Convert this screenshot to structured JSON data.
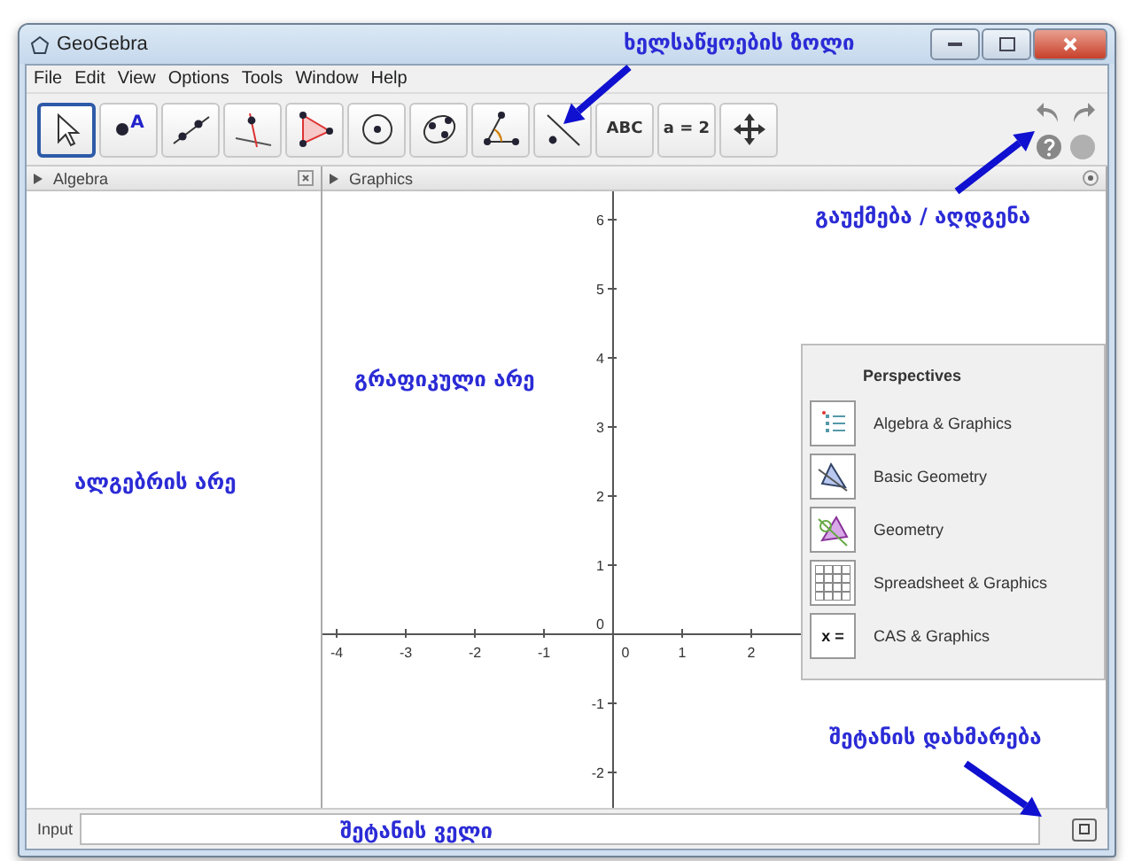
{
  "window": {
    "title": "GeoGebra"
  },
  "menu": [
    "File",
    "Edit",
    "View",
    "Options",
    "Tools",
    "Window",
    "Help"
  ],
  "tools": [
    {
      "kind": "move",
      "selected": true
    },
    {
      "kind": "point",
      "label": "A",
      "selected": false
    },
    {
      "kind": "line",
      "selected": false
    },
    {
      "kind": "perpendicular",
      "selected": false
    },
    {
      "kind": "polygon",
      "selected": false
    },
    {
      "kind": "circle",
      "selected": false
    },
    {
      "kind": "conic",
      "selected": false
    },
    {
      "kind": "angle",
      "selected": false
    },
    {
      "kind": "reflect",
      "selected": false
    },
    {
      "kind": "text",
      "label": "ABC",
      "selected": false
    },
    {
      "kind": "slider",
      "label": "a = 2",
      "selected": false
    },
    {
      "kind": "move_view",
      "selected": false
    }
  ],
  "algebra_panel": {
    "title": "Algebra"
  },
  "graphics_panel": {
    "title": "Graphics",
    "x_ticks": [
      "-4",
      "-3",
      "-2",
      "-1",
      "0",
      "1",
      "2"
    ],
    "y_ticks": [
      "6",
      "5",
      "4",
      "3",
      "2",
      "1",
      "0",
      "-1",
      "-2"
    ]
  },
  "perspectives": {
    "title": "Perspectives",
    "items": [
      {
        "kind": "algebra",
        "label": "Algebra & Graphics"
      },
      {
        "kind": "basic_geometry",
        "label": "Basic Geometry"
      },
      {
        "kind": "geometry",
        "label": "Geometry"
      },
      {
        "kind": "spreadsheet",
        "label": "Spreadsheet & Graphics"
      },
      {
        "kind": "cas",
        "label": "CAS & Graphics",
        "icon_text": "x ="
      }
    ]
  },
  "input_bar": {
    "label": "Input"
  },
  "annotations": {
    "toolbar": "ხელსაწყოების ზოლი",
    "undo_redo": "გაუქმება / აღდგენა",
    "graphics_view": "გრაფიკული არე",
    "algebra_view": "ალგებრის არე",
    "input_help": "შეტანის დახმარება",
    "input_field": "შეტანის ველი"
  }
}
